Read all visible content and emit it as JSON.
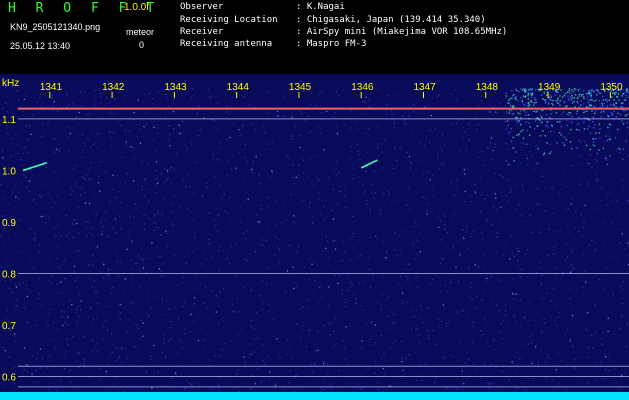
{
  "header": {
    "app_title": "H R O F F T",
    "version": "1.0.0f",
    "filename": "KN9_2505121340.png",
    "timestamp": "25.05.12 13:40",
    "meteor_label": "meteor",
    "meteor_count": "0",
    "info_rows": [
      {
        "label": "Observer",
        "value": ": K.Nagai"
      },
      {
        "label": "Receiving Location",
        "value": ": Chigasaki, Japan (139.414 35.340)"
      },
      {
        "label": "Receiver",
        "value": ": AirSpy mini (Miakejima VOR 108.65MHz)"
      },
      {
        "label": "Receiving antenna",
        "value": ": Maspro FM-3"
      }
    ]
  },
  "chart_data": {
    "type": "heatmap",
    "ylabel": "kHz",
    "x_ticks": [
      "1341",
      "1342",
      "1343",
      "1344",
      "1345",
      "1346",
      "1347",
      "1348",
      "1349",
      "1350"
    ],
    "y_ticks": [
      "1.1",
      "1.0",
      "0.9",
      "0.8",
      "0.7",
      "0.6"
    ],
    "ylim": [
      0.57,
      1.16
    ],
    "xlim": [
      1340.2,
      1350.3
    ],
    "horizontal_lines_khz": [
      1.12,
      1.1,
      0.8,
      0.62,
      0.6,
      0.58
    ],
    "meteor_echoes": [
      {
        "x_start": 1340.57,
        "x_end": 1340.95,
        "y_start": 1.0,
        "y_end": 1.015
      },
      {
        "x_start": 1346.0,
        "x_end": 1346.26,
        "y_start": 1.005,
        "y_end": 1.02
      }
    ],
    "colors": {
      "background": "#0a0a5a",
      "noise": "#3a4ad8",
      "carrier": "#ff7070",
      "lines": "#c8c8ff",
      "labels": "#ffff00",
      "baseline": "#00e0ff"
    }
  }
}
